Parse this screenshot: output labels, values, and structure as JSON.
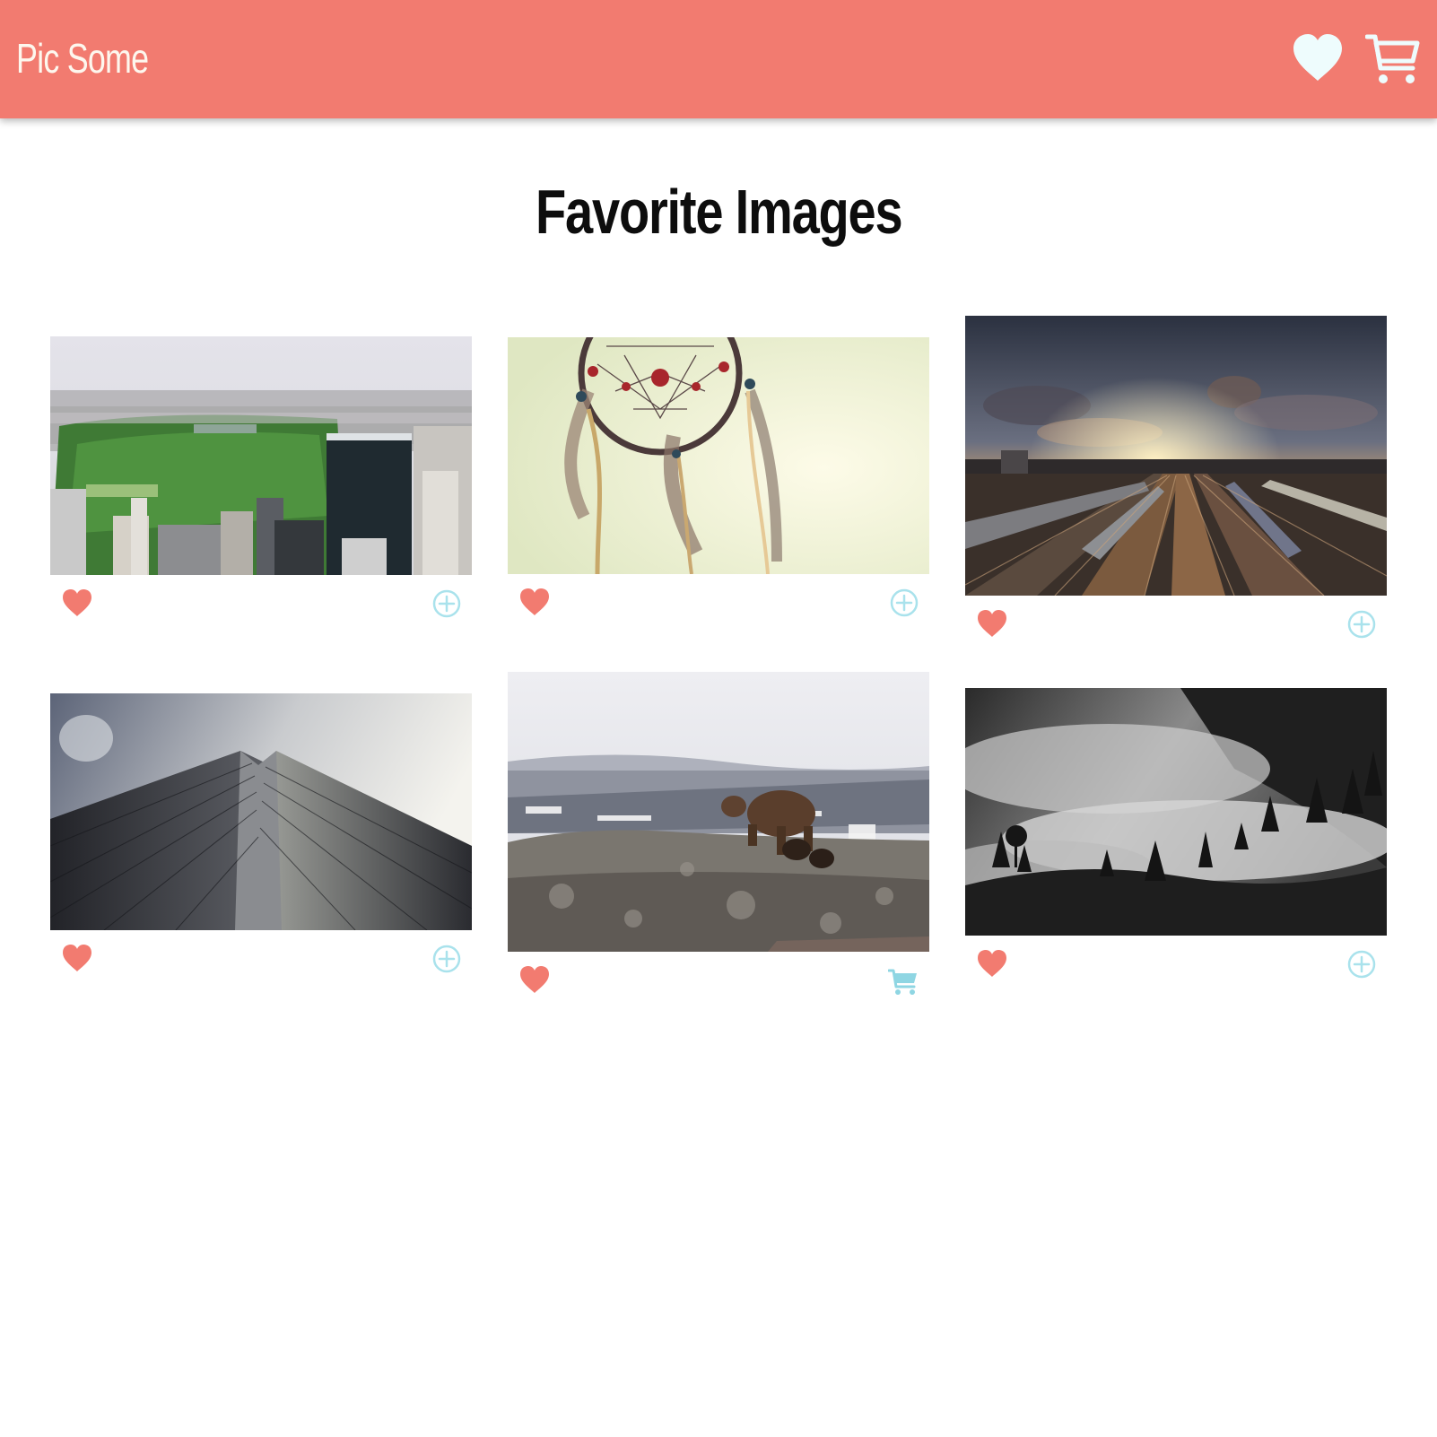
{
  "app": {
    "logo": "Pic Some"
  },
  "navbar": {
    "background": "#f27b70",
    "favorites_icon": "heart-icon",
    "cart_icon": "cart-icon"
  },
  "main": {
    "title": "Favorite Images"
  },
  "colors": {
    "accent": "#f27b70",
    "secondary": "#a9e2ec"
  },
  "images": [
    {
      "subject": "city park aerial",
      "favorited": true,
      "in_cart": false,
      "action_icon": "plus-circle-icon"
    },
    {
      "subject": "dreamcatcher",
      "favorited": true,
      "in_cart": false,
      "action_icon": "plus-circle-icon"
    },
    {
      "subject": "rail yard sunset",
      "favorited": true,
      "in_cart": false,
      "action_icon": "plus-circle-icon"
    },
    {
      "subject": "skyscraper",
      "favorited": true,
      "in_cart": false,
      "action_icon": "plus-circle-icon"
    },
    {
      "subject": "bear on rocks",
      "favorited": true,
      "in_cart": true,
      "action_icon": "cart-icon"
    },
    {
      "subject": "misty forest",
      "favorited": true,
      "in_cart": false,
      "action_icon": "plus-circle-icon"
    }
  ]
}
